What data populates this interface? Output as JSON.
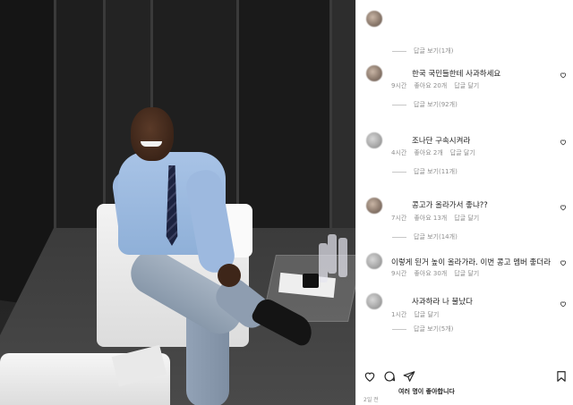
{
  "post_photo": {
    "alt": "photo"
  },
  "comments": [
    {
      "text": "",
      "time": "",
      "likes": "",
      "reply": "",
      "view_replies": "답글 보기(1개)",
      "avatar_style": "color"
    },
    {
      "text": "한국 국민들한테 사과하세요",
      "time": "9시간",
      "likes": "좋아요 20개",
      "reply": "답글 달기",
      "view_replies": "답글 보기(92개)",
      "avatar_style": "color"
    },
    {
      "text": "조나단 구속시켜라",
      "time": "4시간",
      "likes": "좋아요 2개",
      "reply": "답글 달기",
      "view_replies": "답글 보기(11개)",
      "avatar_style": "gray"
    },
    {
      "text": "콩고가 올라가서 좋냐??",
      "time": "7시간",
      "likes": "좋아요 13개",
      "reply": "답글 달기",
      "view_replies": "답글 보기(14개)",
      "avatar_style": "color"
    },
    {
      "text": "이렇게 된거 높이 올라가라. 이번 콩고 멤버 좋더라",
      "time": "9시간",
      "likes": "좋아요 30개",
      "reply": "답글 달기",
      "view_replies": "",
      "avatar_style": "gray"
    },
    {
      "text": "사과하라 나 불났다",
      "time": "1시간",
      "likes": "",
      "reply": "답글 달기",
      "view_replies": "답글 보기(5개)",
      "avatar_style": "gray"
    }
  ],
  "actions": {
    "like_icon": "heart-icon",
    "comment_icon": "comment-icon",
    "share_icon": "send-icon",
    "save_icon": "bookmark-icon"
  },
  "likes_summary": "여러 명이 좋아합니다",
  "post_time": "2일 전"
}
